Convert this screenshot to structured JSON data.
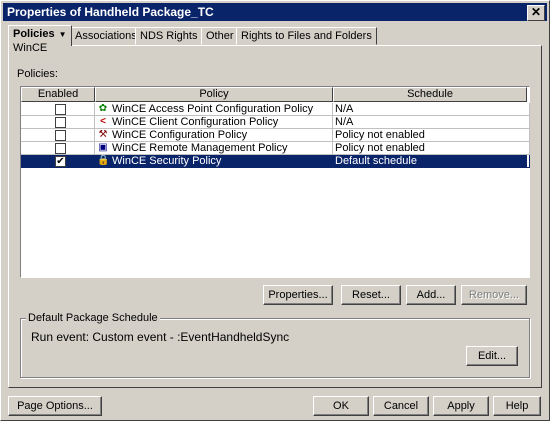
{
  "window": {
    "title": "Properties of Handheld Package_TC",
    "close_glyph": "✕"
  },
  "tabs": [
    {
      "label": "Policies",
      "dropdown": true
    },
    {
      "label": "Associations",
      "dropdown": false
    },
    {
      "label": "NDS Rights",
      "dropdown": true
    },
    {
      "label": "Other",
      "dropdown": false
    },
    {
      "label": "Rights to Files and Folders",
      "dropdown": false
    }
  ],
  "subtab": "WinCE",
  "policies_label": "Policies:",
  "table": {
    "headers": [
      "Enabled",
      "Policy",
      "Schedule"
    ],
    "rows": [
      {
        "enabled": false,
        "icon": "access-point-icon",
        "policy": "WinCE Access Point Configuration Policy",
        "schedule": "N/A",
        "selected": false
      },
      {
        "enabled": false,
        "icon": "client-config-icon",
        "policy": "WinCE Client Configuration Policy",
        "schedule": "N/A",
        "selected": false
      },
      {
        "enabled": false,
        "icon": "config-policy-icon",
        "policy": "WinCE Configuration Policy",
        "schedule": "Policy not enabled",
        "selected": false
      },
      {
        "enabled": false,
        "icon": "remote-management-icon",
        "policy": "WinCE Remote Management Policy",
        "schedule": "Policy not enabled",
        "selected": false
      },
      {
        "enabled": true,
        "icon": "lock-icon",
        "policy": "WinCE Security Policy",
        "schedule": "Default schedule",
        "selected": true
      }
    ]
  },
  "table_buttons": {
    "properties": "Properties...",
    "reset": "Reset...",
    "add": "Add...",
    "remove": "Remove..."
  },
  "schedule_group": {
    "legend": "Default Package Schedule",
    "run_event": "Run event: Custom event - :EventHandheldSync",
    "edit": "Edit..."
  },
  "footer": {
    "page_options": "Page Options...",
    "ok": "OK",
    "cancel": "Cancel",
    "apply": "Apply",
    "help": "Help"
  },
  "colors": {
    "selection": "#0a246a",
    "face": "#d4d0c8"
  }
}
